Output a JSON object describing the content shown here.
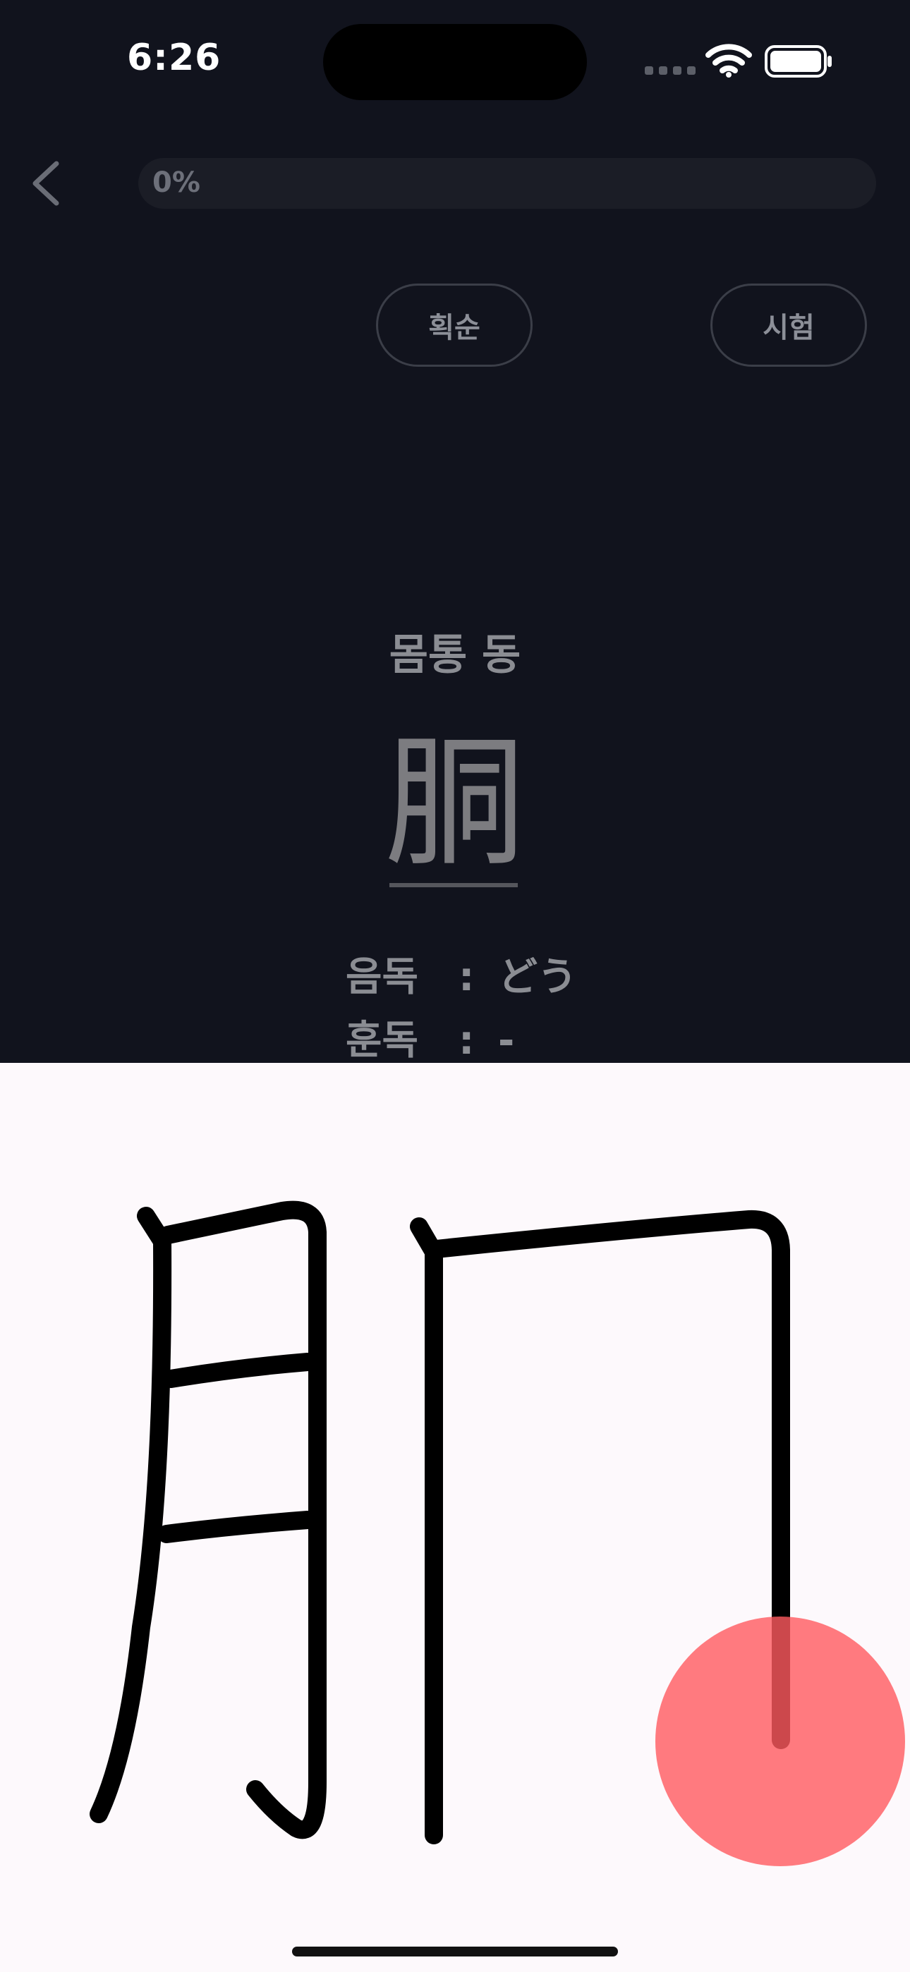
{
  "status_bar": {
    "time": "6:26",
    "wifi_icon": "wifi-icon",
    "battery_icon": "battery-icon",
    "signal_icon": "signal-dots-icon"
  },
  "top_bar": {
    "back_icon": "chevron-left-icon",
    "progress_label": "0%",
    "progress_fraction": 0
  },
  "buttons": {
    "stroke_order": "획순",
    "test": "시험"
  },
  "kanji": {
    "meaning": "몸통 동",
    "character": "胴",
    "on_label": "음독",
    "on_value": "どう",
    "kun_label": "훈독",
    "kun_value": "-",
    "separator": ":"
  },
  "canvas": {
    "background": "#fdf9fc",
    "stroke_color": "#000000",
    "cursor_color": "#ff6b6e",
    "strokes_drawn": 6
  },
  "colors": {
    "background": "#11131d",
    "progress_track": "#1b1d26",
    "muted_text": "#8b8d93"
  }
}
